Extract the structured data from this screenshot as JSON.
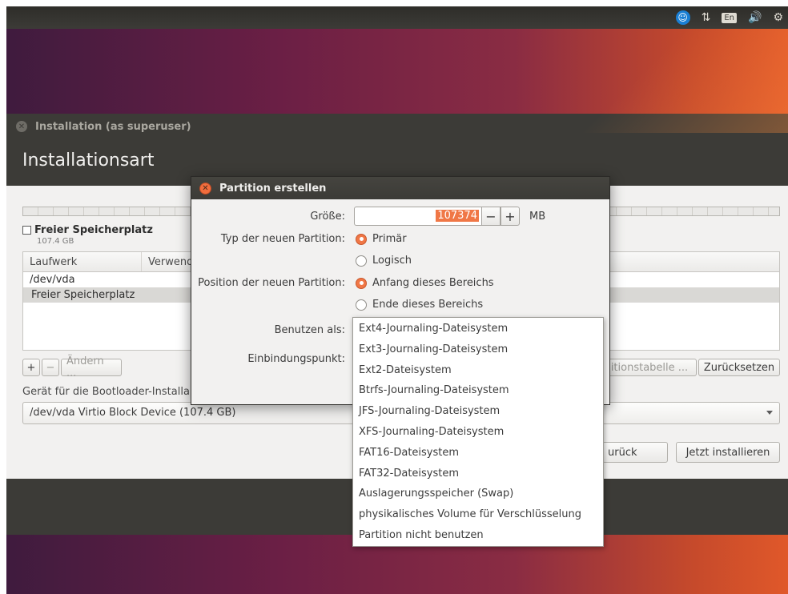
{
  "top_panel": {
    "keyboard_layout": "En",
    "icons": [
      "accessibility-icon",
      "network-icon",
      "keyboard-layout-icon",
      "volume-icon",
      "settings-gear-icon"
    ]
  },
  "installer": {
    "window_title": "Installation (as superuser)",
    "heading": "Installationsart",
    "free_space_label": "Freier Speicherplatz",
    "free_space_size": "107.4 GB",
    "table": {
      "columns": [
        "Laufwerk",
        "Verwend"
      ],
      "rows": [
        "/dev/vda",
        "Freier Speicherplatz"
      ]
    },
    "add_label": "+",
    "remove_label": "−",
    "change_label": "Ändern ...",
    "new_table_label": "itionstabelle ...",
    "reset_label": "Zurücksetzen",
    "bootloader_label": "Gerät für die Bootloader-Installa",
    "bootloader_device": "/dev/vda Virtio Block Device (107.4 GB)",
    "back_label": "urück",
    "install_label": "Jetzt installieren"
  },
  "dialog": {
    "title": "Partition erstellen",
    "size_label": "Größe:",
    "size_value": "107374",
    "minus": "−",
    "plus": "+",
    "unit": "MB",
    "type_label": "Typ der neuen Partition:",
    "type_primary": "Primär",
    "type_logical": "Logisch",
    "position_label": "Position der neuen Partition:",
    "position_start": "Anfang dieses Bereichs",
    "position_end": "Ende dieses Bereichs",
    "use_as_label": "Benutzen als:",
    "mount_label": "Einbindungspunkt:"
  },
  "use_as_options": [
    "Ext4-Journaling-Dateisystem",
    "Ext3-Journaling-Dateisystem",
    "Ext2-Dateisystem",
    "Btrfs-Journaling-Dateisystem",
    "JFS-Journaling-Dateisystem",
    "XFS-Journaling-Dateisystem",
    "FAT16-Dateisystem",
    "FAT32-Dateisystem",
    "Auslagerungsspeicher (Swap)",
    "physikalisches Volume für Verschlüsselung",
    "Partition nicht benutzen"
  ]
}
